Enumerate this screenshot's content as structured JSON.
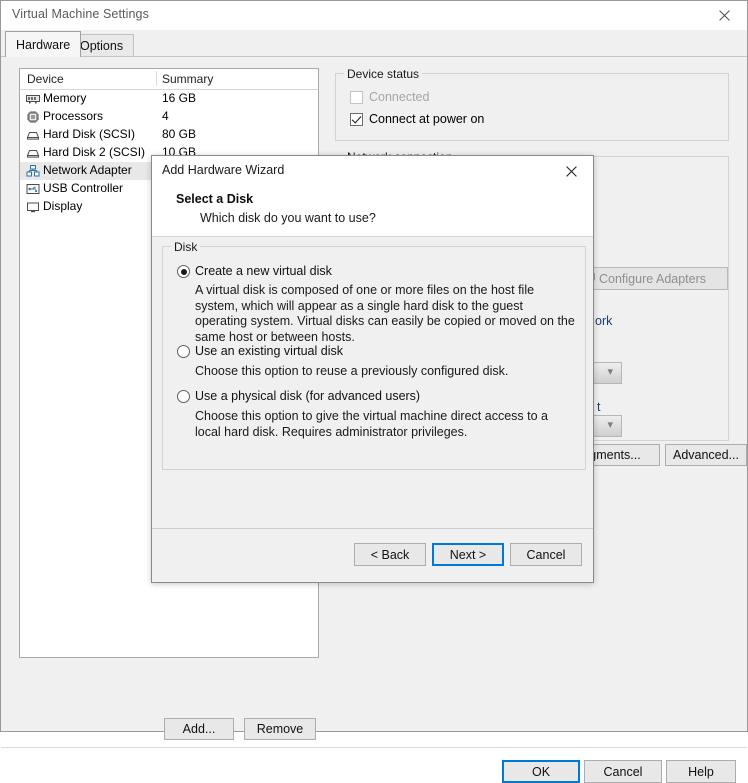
{
  "window": {
    "title": "Virtual Machine Settings",
    "close_icon": "close-icon"
  },
  "tabs": [
    {
      "label": "Hardware",
      "active": true
    },
    {
      "label": "Options",
      "active": false
    }
  ],
  "device_list": {
    "columns": [
      "Device",
      "Summary"
    ],
    "rows": [
      {
        "icon": "memory-icon",
        "device": "Memory",
        "summary": "16 GB",
        "selected": false
      },
      {
        "icon": "processor-icon",
        "device": "Processors",
        "summary": "4",
        "selected": false
      },
      {
        "icon": "hard-disk-icon",
        "device": "Hard Disk (SCSI)",
        "summary": "80 GB",
        "selected": false
      },
      {
        "icon": "hard-disk-icon",
        "device": "Hard Disk 2 (SCSI)",
        "summary": "10 GB",
        "selected": false
      },
      {
        "icon": "network-adapter-icon",
        "device": "Network Adapter",
        "summary": "",
        "selected": true
      },
      {
        "icon": "usb-controller-icon",
        "device": "USB Controller",
        "summary": "",
        "selected": false
      },
      {
        "icon": "display-icon",
        "device": "Display",
        "summary": "",
        "selected": false
      }
    ]
  },
  "device_buttons": {
    "add": "Add...",
    "remove": "Remove"
  },
  "right_pane": {
    "device_status": {
      "title": "Device status",
      "connected": {
        "label": "Connected",
        "checked": false,
        "enabled": false
      },
      "connect_at_power_on": {
        "label": "Connect at power on",
        "checked": true,
        "enabled": true
      }
    },
    "network_connection": {
      "title": "Network connection",
      "configure_adapters": "Configure Adapters",
      "configure_adapters_icon": "shield-icon",
      "partial_label_ork": "ork",
      "partial_label_t": "t",
      "combo_chevron": "chevron-down-icon",
      "lan_segments": "gments...",
      "advanced": "Advanced..."
    }
  },
  "dialog_buttons": {
    "ok": "OK",
    "cancel": "Cancel",
    "help": "Help"
  },
  "wizard": {
    "title": "Add Hardware Wizard",
    "close_icon": "close-icon",
    "heading": "Select a Disk",
    "subheading": "Which disk do you want to use?",
    "group_title": "Disk",
    "options": [
      {
        "label": "Create a new virtual disk",
        "selected": true,
        "description": "A virtual disk is composed of one or more files on the host file system, which will appear as a single hard disk to the guest operating system. Virtual disks can easily be copied or moved on the same host or between hosts."
      },
      {
        "label": "Use an existing virtual disk",
        "selected": false,
        "description": "Choose this option to reuse a previously configured disk."
      },
      {
        "label": "Use a physical disk (for advanced users)",
        "selected": false,
        "description": "Choose this option to give the virtual machine direct access to a local hard disk. Requires administrator privileges."
      }
    ],
    "buttons": {
      "back": "< Back",
      "next": "Next >",
      "cancel": "Cancel"
    }
  },
  "colors": {
    "focus_blue": "#0078d7",
    "window_bg": "#f0f0f0",
    "list_bg": "#ffffff",
    "selected_row": "#e8e8e8"
  }
}
